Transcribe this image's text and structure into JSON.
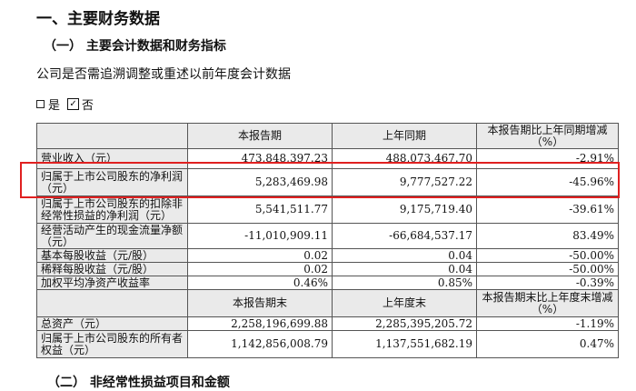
{
  "doc": {
    "title": "一、主要财务数据",
    "subtitle": "（一） 主要会计数据和财务指标",
    "question": "公司是否需追溯调整或重述以前年度会计数据",
    "option_yes": "是",
    "option_no": "否",
    "next_section": "（二） 非经常性损益项目和金额"
  },
  "table1": {
    "headers": [
      "",
      "本报告期",
      "上年同期",
      "本报告期比上年同期增减（%）"
    ],
    "rows": [
      [
        "营业收入（元）",
        "473,848,397.23",
        "488,073,467.70",
        "-2.91%"
      ],
      [
        "归属于上市公司股东的净利润（元）",
        "5,283,469.98",
        "9,777,527.22",
        "-45.96%"
      ],
      [
        "归属于上市公司股东的扣除非经常性损益的净利润（元）",
        "5,541,511.77",
        "9,175,719.40",
        "-39.61%"
      ],
      [
        "经营活动产生的现金流量净额（元）",
        "-11,010,909.11",
        "-66,684,537.17",
        "83.49%"
      ],
      [
        "基本每股收益（元/股）",
        "0.02",
        "0.04",
        "-50.00%"
      ],
      [
        "稀释每股收益（元/股）",
        "0.02",
        "0.04",
        "-50.00%"
      ],
      [
        "加权平均净资产收益率",
        "0.46%",
        "0.85%",
        "-0.39%"
      ]
    ]
  },
  "table2": {
    "headers": [
      "",
      "本报告期末",
      "上年度末",
      "本报告期末比上年度末增减（%）"
    ],
    "rows": [
      [
        "总资产（元）",
        "2,258,196,699.88",
        "2,285,395,205.72",
        "-1.19%"
      ],
      [
        "归属于上市公司股东的所有者权益（元）",
        "1,142,856,008.79",
        "1,137,551,682.19",
        "0.47%"
      ]
    ]
  }
}
